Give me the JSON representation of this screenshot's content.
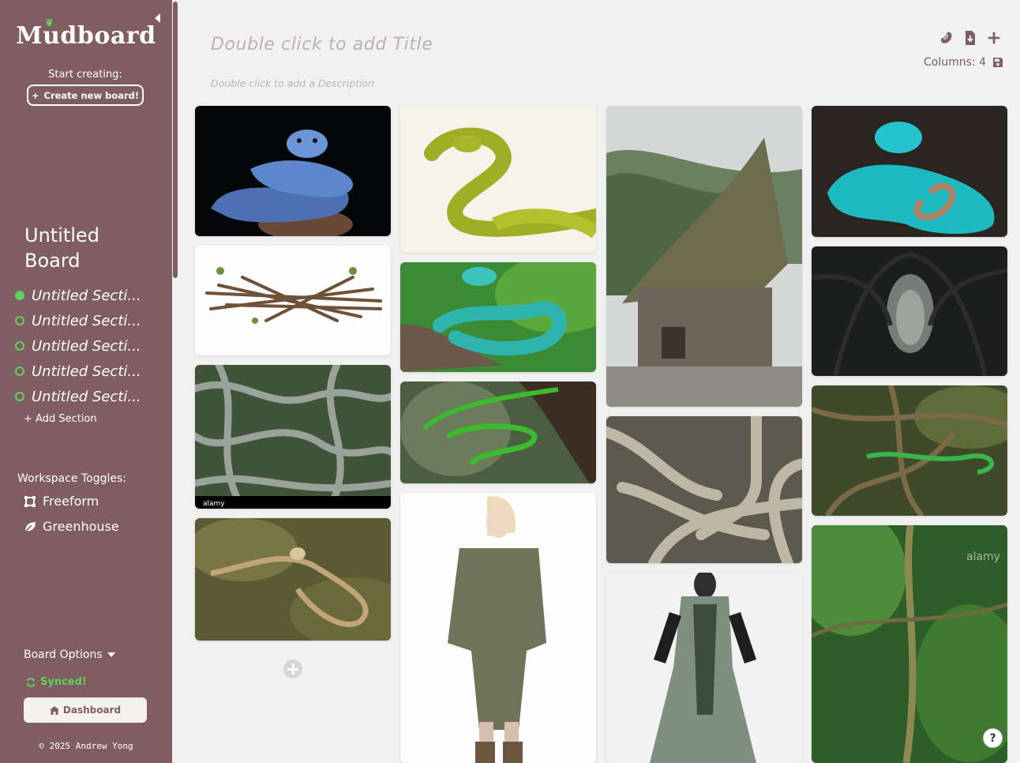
{
  "sidebar": {
    "logo_text": "Mudboard",
    "start_label": "Start creating:",
    "create_button": "Create new board!",
    "board_title": "Untitled Board",
    "sections": [
      {
        "label": "Untitled Secti...",
        "active": true
      },
      {
        "label": "Untitled Secti...",
        "active": false
      },
      {
        "label": "Untitled Secti...",
        "active": false
      },
      {
        "label": "Untitled Secti...",
        "active": false
      },
      {
        "label": "Untitled Secti...",
        "active": false
      }
    ],
    "add_section": "+ Add Section",
    "workspace_label": "Workspace Toggles:",
    "freeform": "Freeform",
    "greenhouse": "Greenhouse",
    "board_options": "Board Options",
    "synced": "Synced!",
    "dashboard": "Dashboard",
    "copyright": "© 2025 Andrew Yong"
  },
  "header": {
    "title_placeholder": "Double click to add Title",
    "description_placeholder": "Double click to add a Description",
    "columns_label": "Columns: 4"
  },
  "board": {
    "columns": [
      {
        "cards": [
          {
            "name": "blue-viper-image",
            "caption": ""
          },
          {
            "name": "twig-bundle-image",
            "caption": ""
          },
          {
            "name": "tangled-vines-image",
            "caption": "alamy"
          },
          {
            "name": "vine-snake-branch-image",
            "caption": ""
          }
        ]
      },
      {
        "cards": [
          {
            "name": "green-snake-image",
            "caption": ""
          },
          {
            "name": "turquoise-viper-image",
            "caption": ""
          },
          {
            "name": "green-vine-snake-image",
            "caption": ""
          },
          {
            "name": "olive-outfit-model-image",
            "caption": ""
          }
        ]
      },
      {
        "cards": [
          {
            "name": "wooden-house-image",
            "caption": ""
          },
          {
            "name": "tree-roots-image",
            "caption": ""
          },
          {
            "name": "green-dress-model-image",
            "caption": ""
          }
        ]
      },
      {
        "cards": [
          {
            "name": "cyan-viper-image",
            "caption": ""
          },
          {
            "name": "dark-forest-tunnel-image",
            "caption": ""
          },
          {
            "name": "jungle-vine-snake-image",
            "caption": ""
          },
          {
            "name": "jungle-liana-image",
            "caption": "alamy"
          }
        ]
      }
    ]
  },
  "colors": {
    "sidebar_bg": "#7f5d60",
    "accent_green": "#5ed25e",
    "page_bg": "#f1f1f1",
    "placeholder_text": "#bdb1b2"
  }
}
